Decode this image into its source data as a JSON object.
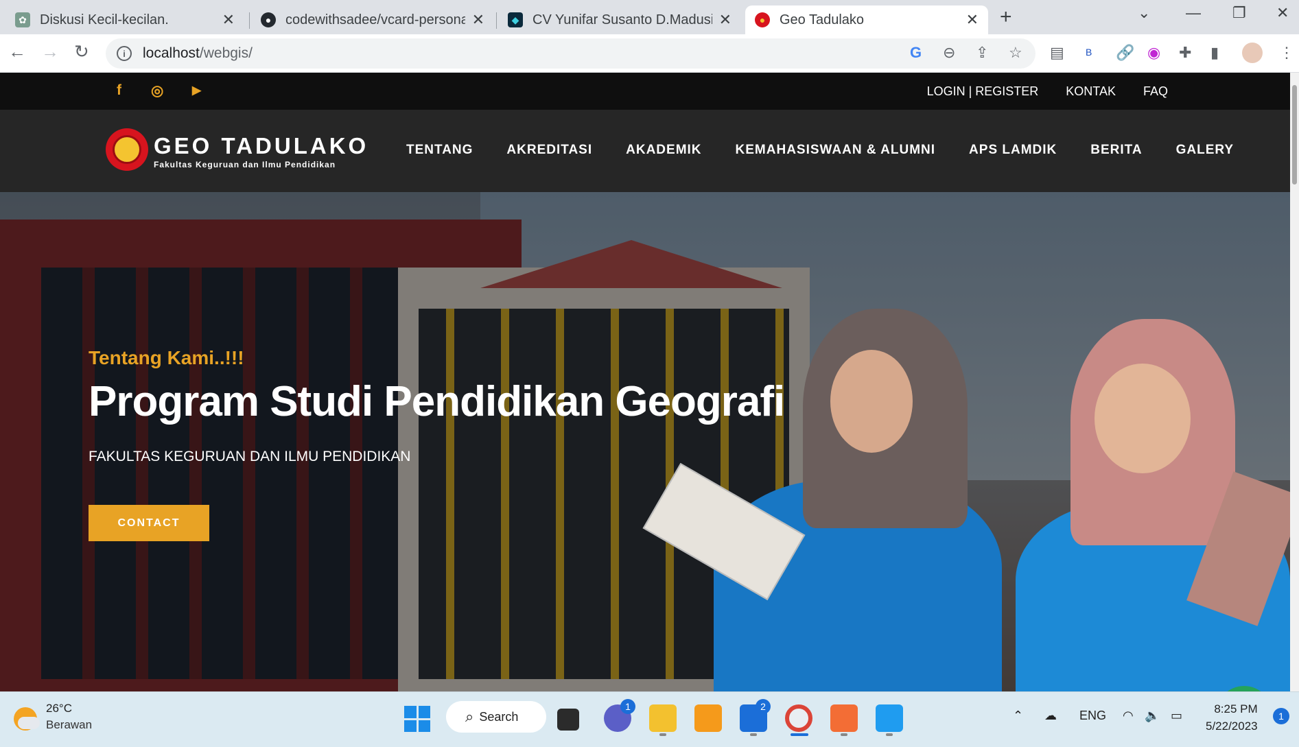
{
  "browser": {
    "tabs": [
      {
        "title": "Diskusi Kecil-kecilan.",
        "active": false
      },
      {
        "title": "codewithsadee/vcard-personal-p",
        "active": false
      },
      {
        "title": "CV Yunifar Susanto D.Madusila",
        "active": false
      },
      {
        "title": "Geo Tadulako",
        "active": true
      }
    ],
    "new_tab": "+",
    "close": "✕",
    "url_host": "localhost",
    "url_path": "/webgis/"
  },
  "site": {
    "top_links": {
      "login": "LOGIN | REGISTER",
      "kontak": "KONTAK",
      "faq": "FAQ"
    },
    "brand_name": "GEO TADULAKO",
    "brand_sub": "Fakultas Keguruan dan Ilmu Pendidikan",
    "menu": [
      "TENTANG",
      "AKREDITASI",
      "AKADEMIK",
      "KEMAHASISWAAN & ALUMNI",
      "APS LAMDIK",
      "BERITA",
      "GALERY"
    ],
    "hero": {
      "kicker": "Tentang Kami..!!!",
      "headline": "Program Studi Pendidikan Geografi",
      "subline": "FAKULTAS KEGURUAN DAN ILMU PENDIDIKAN",
      "cta": "CONTACT"
    },
    "accent_color": "#e8a325"
  },
  "taskbar": {
    "weather_temp": "26°C",
    "weather_cond": "Berawan",
    "search_label": "Search",
    "teams_badge": "1",
    "mail_badge": "2",
    "lang": "ENG",
    "time": "8:25 PM",
    "date": "5/22/2023",
    "notifications": "1"
  }
}
